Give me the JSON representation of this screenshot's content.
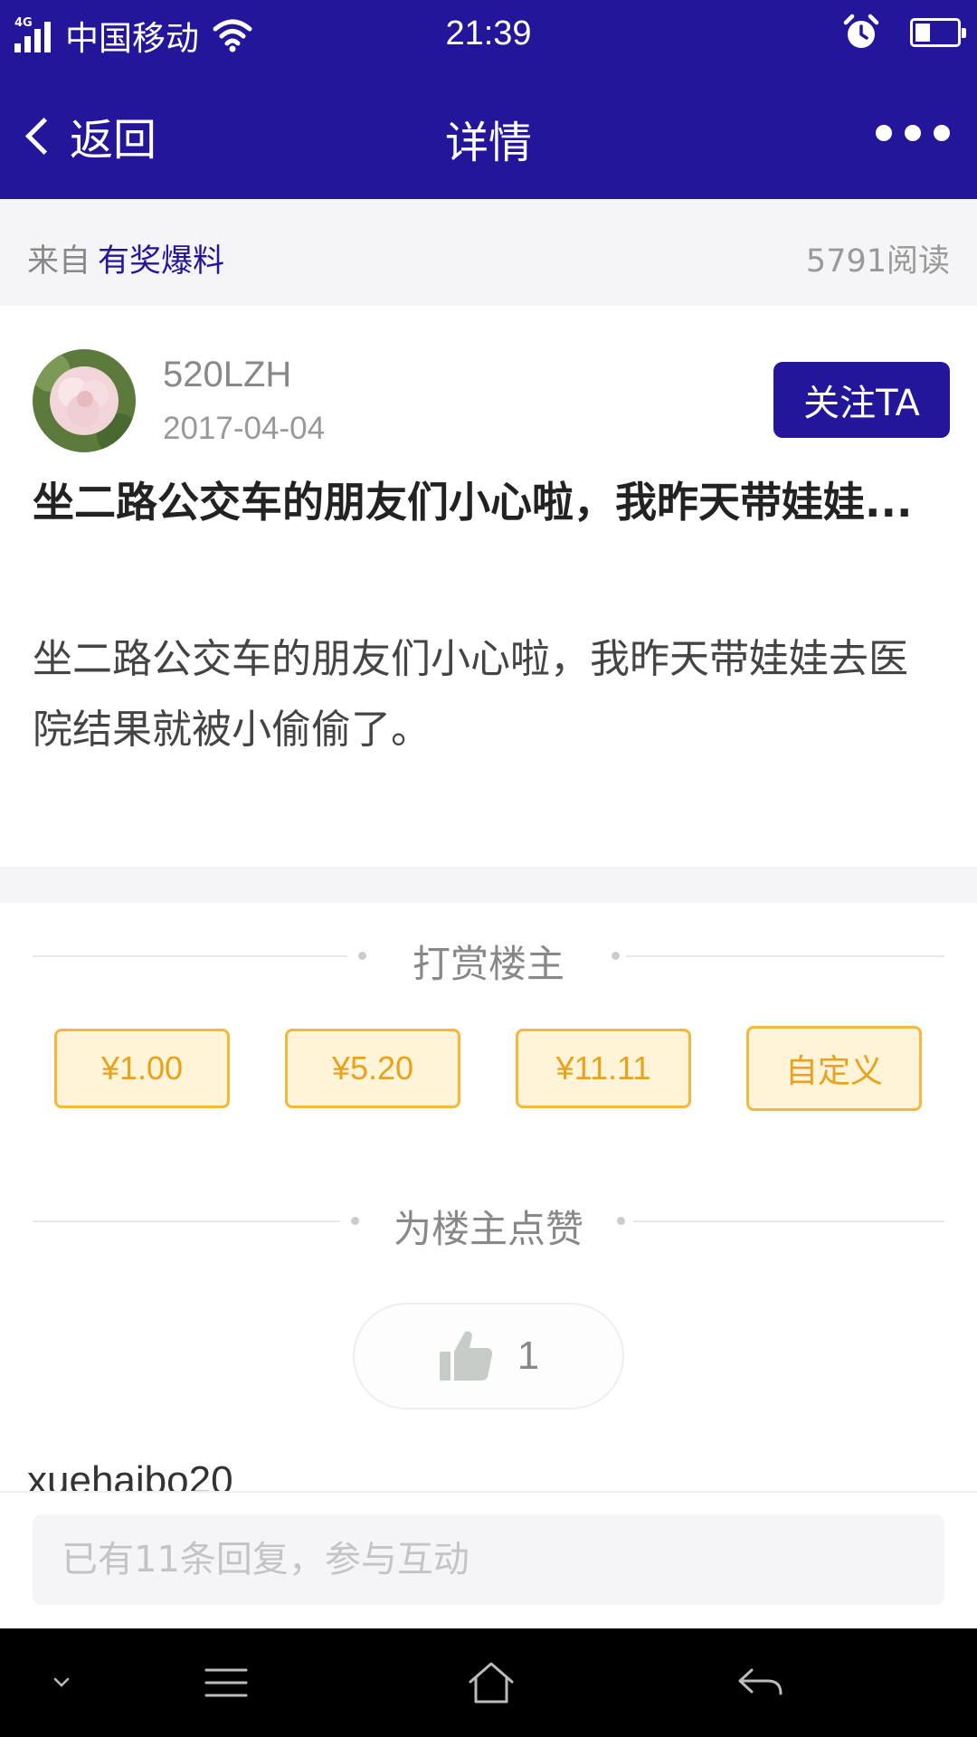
{
  "status_bar": {
    "network": "4G",
    "carrier": "中国移动",
    "time": "21:39",
    "icons": [
      "signal-icon",
      "wifi-icon",
      "alarm-icon",
      "battery-icon"
    ]
  },
  "nav": {
    "back_label": "返回",
    "title": "详情",
    "more_icon": "more-dots-icon"
  },
  "source": {
    "prefix": "来自",
    "channel": "有奖爆料",
    "reads": "5791阅读"
  },
  "post": {
    "author": "520LZH",
    "date": "2017-04-04",
    "follow_label": "关注TA",
    "title": "坐二路公交车的朋友们小心啦，我昨天带娃娃...",
    "body": "坐二路公交车的朋友们小心啦，我昨天带娃娃去医院结果就被小偷偷了。"
  },
  "reward": {
    "heading": "打赏楼主",
    "options": [
      "¥1.00",
      "¥5.20",
      "¥11.11",
      "自定义"
    ]
  },
  "like": {
    "heading": "为楼主点赞",
    "count": "1",
    "icon": "thumbs-up-icon"
  },
  "comments": {
    "first_author_partial": "xuehaibo20"
  },
  "reply": {
    "placeholder": "已有11条回复，参与互动"
  },
  "colors": {
    "brand": "#24169a",
    "reward_bg": "#fff3d8",
    "reward_border": "#f5b73c",
    "reward_text": "#e8a21c"
  }
}
